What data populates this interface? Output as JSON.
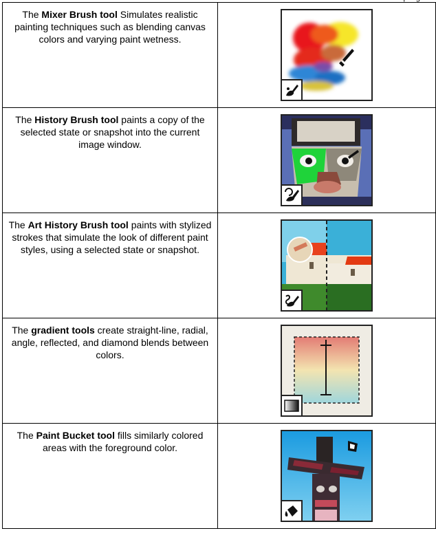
{
  "top_fragment": "spring",
  "rows": [
    {
      "pre": "The ",
      "tool": "Mixer Brush tool",
      "post": " Simulates realistic painting techniques such as blending canvas colors and varying paint wetness.",
      "image_icon": "mixer-brush-icon"
    },
    {
      "pre": "The ",
      "tool": "History Brush tool",
      "post": " paints a copy of the selected state or snapshot into the current image window.",
      "image_icon": "history-brush-icon"
    },
    {
      "pre": "The ",
      "tool": "Art History Brush tool",
      "post": " paints with stylized strokes that simulate the look of different paint styles, using a selected state or snapshot.",
      "image_icon": "art-history-brush-icon"
    },
    {
      "pre": "The ",
      "tool": "gradient tools",
      "post": " create straight-line, radial, angle, reflected, and diamond blends between colors.",
      "image_icon": "gradient-icon"
    },
    {
      "pre": "The ",
      "tool": "Paint Bucket tool",
      "post": " fills similarly colored areas with the foreground color.",
      "image_icon": "paint-bucket-icon"
    }
  ]
}
